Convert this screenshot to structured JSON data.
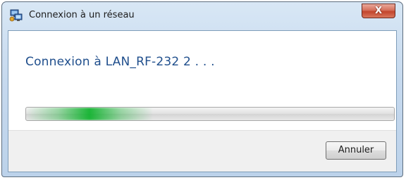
{
  "window": {
    "title": "Connexion à un réseau",
    "close_label": "X"
  },
  "main": {
    "heading": "Connexion à LAN_RF-232 2 . . ."
  },
  "progress": {
    "state": "indeterminate",
    "color": "#06b025"
  },
  "footer": {
    "cancel_label": "Annuler"
  },
  "icons": {
    "title_icon": "network-connection-icon"
  },
  "colors": {
    "heading": "#1f4e8c",
    "close_button": "#c2452c",
    "frame": "#c6d9ee"
  }
}
